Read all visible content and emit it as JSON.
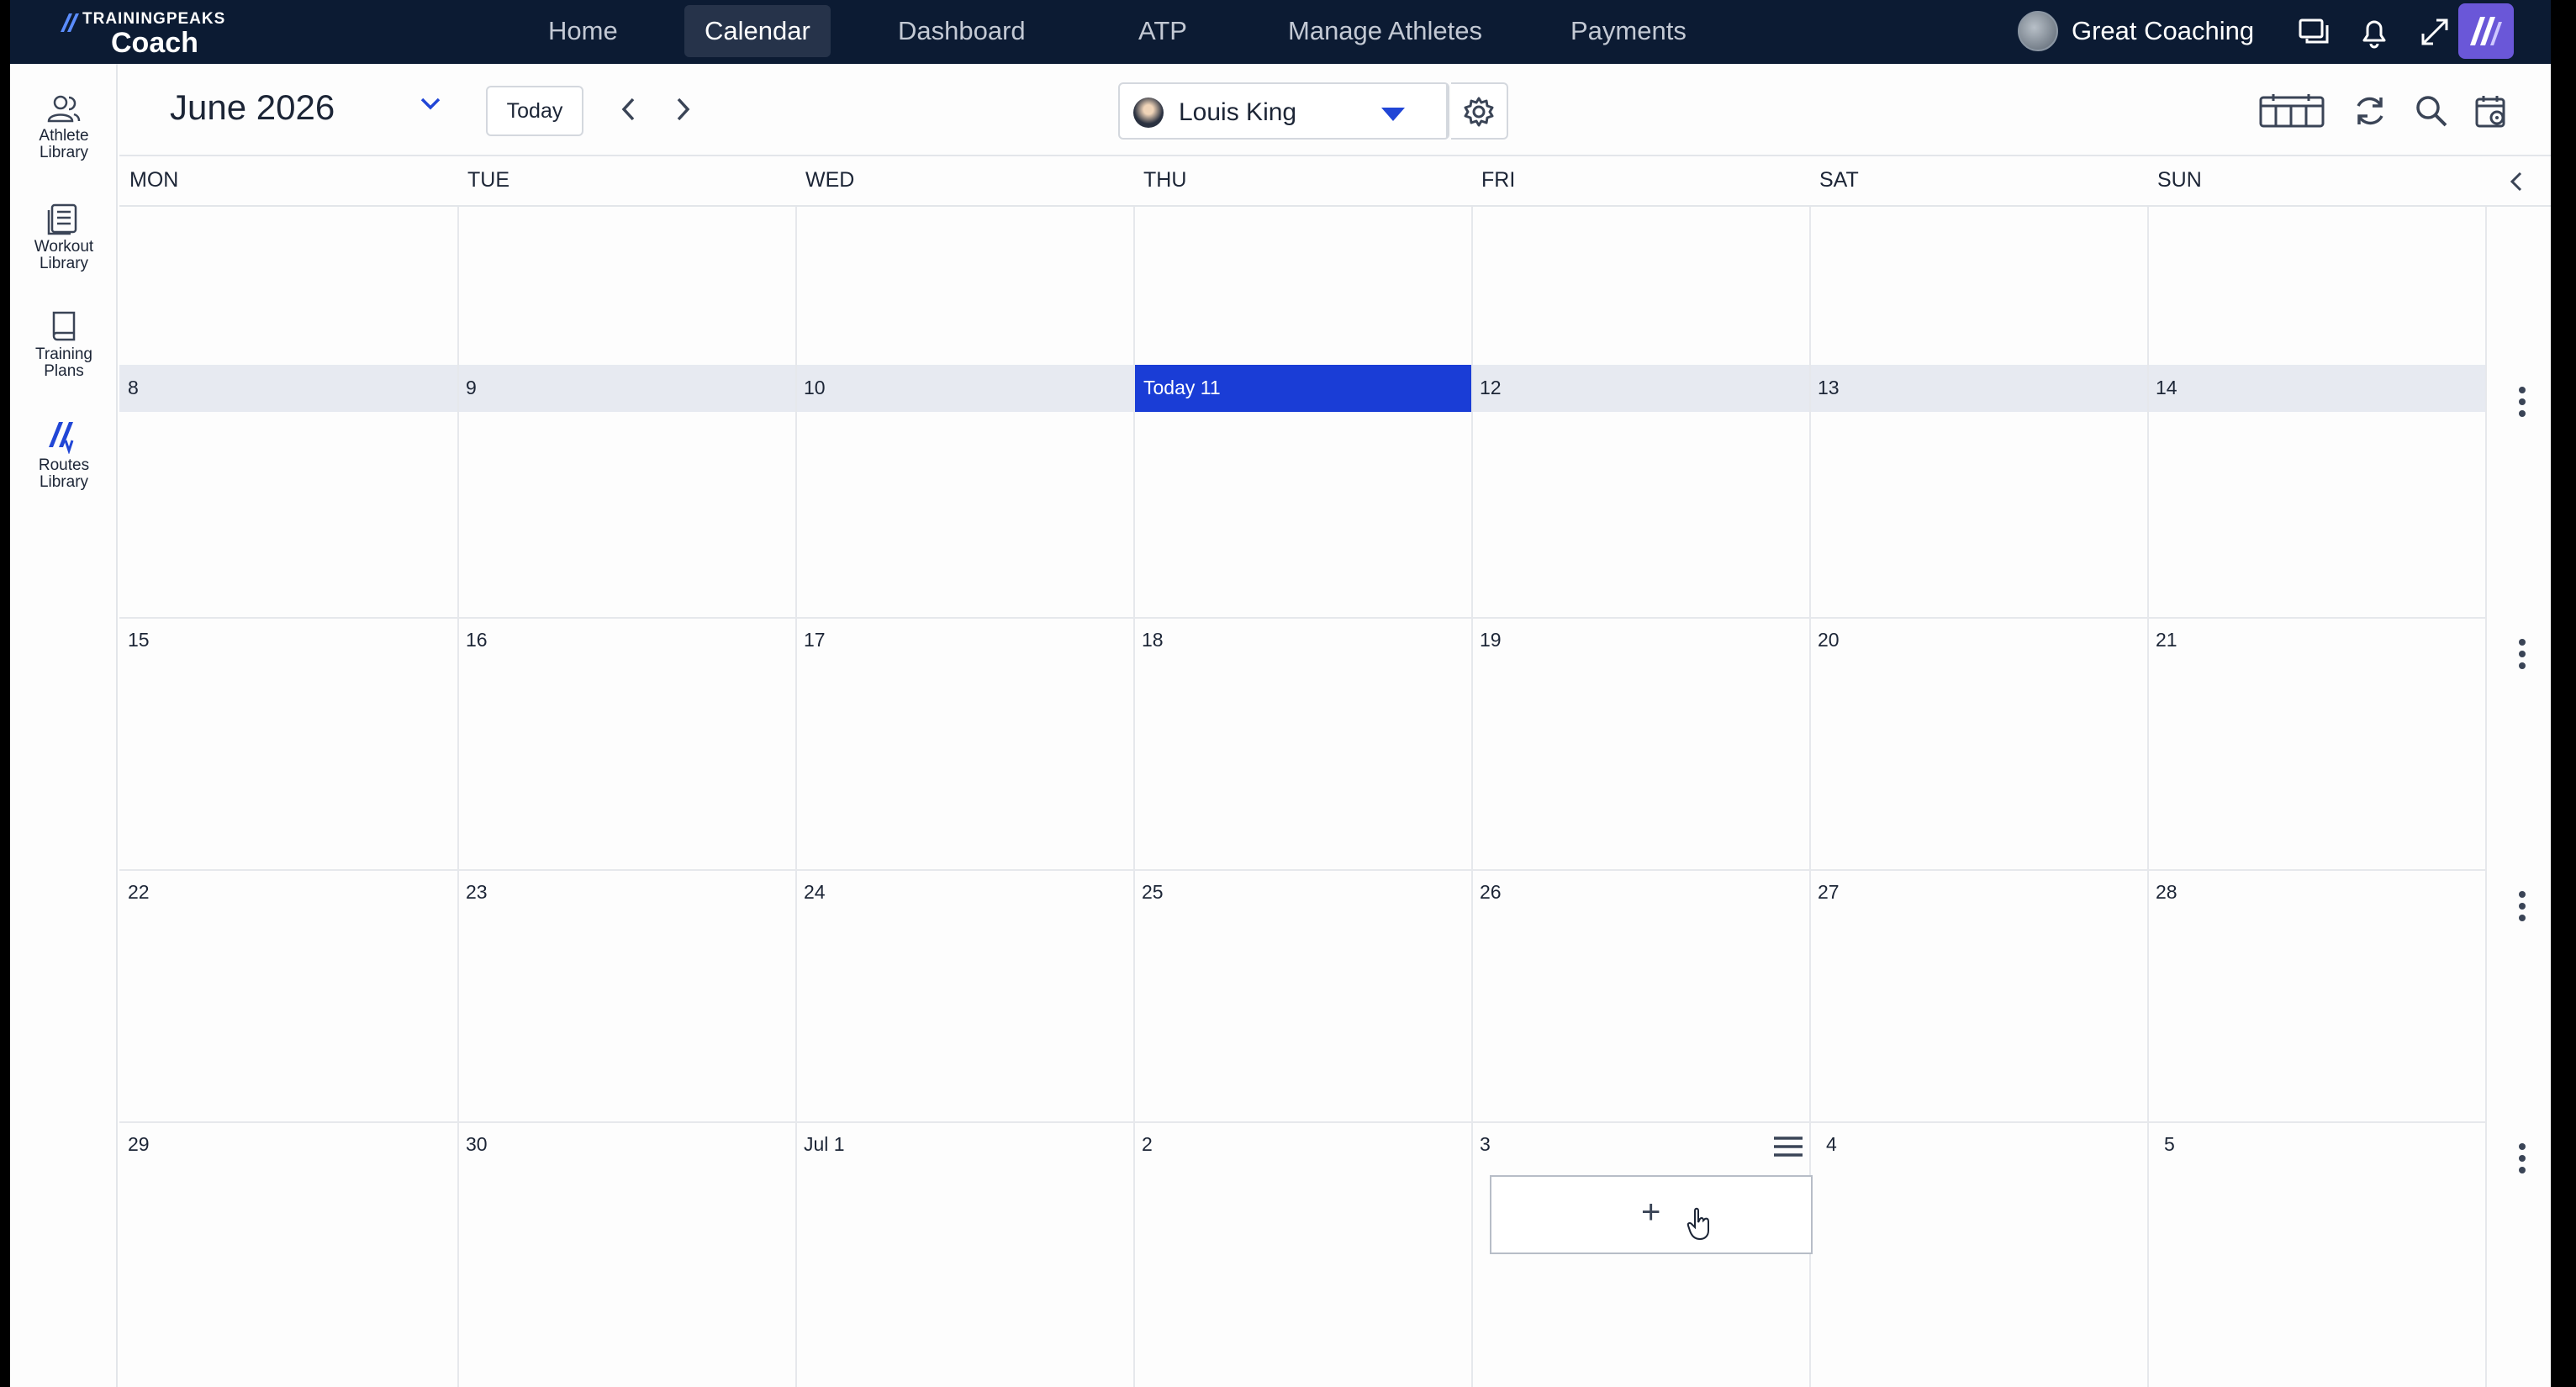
{
  "brand": {
    "top": "TRAININGPEAKS",
    "product": "Coach"
  },
  "nav": {
    "items": [
      {
        "label": "Home",
        "active": false
      },
      {
        "label": "Calendar",
        "active": true
      },
      {
        "label": "Dashboard",
        "active": false
      },
      {
        "label": "ATP",
        "active": false
      },
      {
        "label": "Manage Athletes",
        "active": false
      },
      {
        "label": "Payments",
        "active": false
      }
    ],
    "user_name": "Great Coaching",
    "icons": [
      "chat-icon",
      "bell-icon",
      "expand-icon",
      "trainingpeaks-app-icon"
    ]
  },
  "sidebar": {
    "items": [
      {
        "line1": "Athlete",
        "line2": "Library",
        "icon": "athletes-icon"
      },
      {
        "line1": "Workout",
        "line2": "Library",
        "icon": "workout-library-icon"
      },
      {
        "line1": "Training",
        "line2": "Plans",
        "icon": "book-icon"
      },
      {
        "line1": "Routes",
        "line2": "Library",
        "icon": "routes-icon"
      }
    ]
  },
  "toolbar": {
    "month": "June 2026",
    "today_label": "Today",
    "athlete_name": "Louis King",
    "icons": [
      "calendar-view-icon",
      "refresh-icon",
      "search-icon",
      "calendar-settings-icon"
    ]
  },
  "calendar": {
    "weekdays": [
      "MON",
      "TUE",
      "WED",
      "THU",
      "FRI",
      "SAT",
      "SUN"
    ],
    "weeks": [
      [
        "",
        "",
        "",
        "",
        "",
        "",
        ""
      ],
      [
        "8",
        "9",
        "10",
        "Today 11",
        "12",
        "13",
        "14"
      ],
      [
        "15",
        "16",
        "17",
        "18",
        "19",
        "20",
        "21"
      ],
      [
        "22",
        "23",
        "24",
        "25",
        "26",
        "27",
        "28"
      ],
      [
        "29",
        "30",
        "Jul 1",
        "2",
        "3",
        "4",
        "5"
      ]
    ],
    "add_label": "+"
  },
  "colors": {
    "nav_bg": "#0c1b33",
    "today": "#1a3dd6",
    "accent": "#2146d6",
    "week_band": "#e7eaf1"
  }
}
